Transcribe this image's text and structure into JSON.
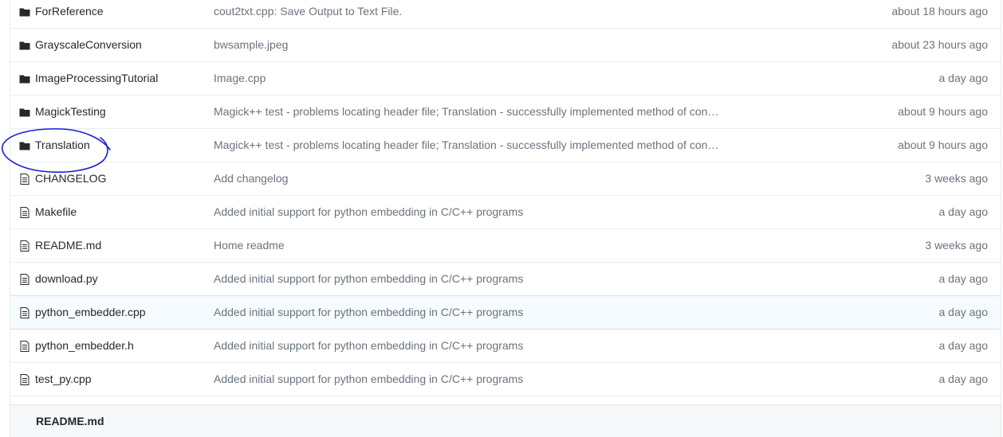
{
  "files": [
    {
      "type": "folder",
      "icon": "folder-icon",
      "name": "ForReference",
      "message": "cout2txt.cpp: Save Output to Text File.",
      "age": "about 18 hours ago"
    },
    {
      "type": "folder",
      "icon": "folder-icon",
      "name": "GrayscaleConversion",
      "message": "bwsample.jpeg",
      "age": "about 23 hours ago"
    },
    {
      "type": "folder",
      "icon": "folder-icon",
      "name": "ImageProcessingTutorial",
      "message": "Image.cpp",
      "age": "a day ago"
    },
    {
      "type": "folder",
      "icon": "folder-icon",
      "name": "MagickTesting",
      "message": "Magick++ test - problems locating header file; Translation - successfully implemented method of conv…",
      "age": "about 9 hours ago"
    },
    {
      "type": "folder",
      "icon": "folder-icon",
      "name": "Translation",
      "message": "Magick++ test - problems locating header file; Translation - successfully implemented method of conv…",
      "age": "about 9 hours ago"
    },
    {
      "type": "file",
      "icon": "file-icon",
      "name": "CHANGELOG",
      "message": "Add changelog",
      "age": "3 weeks ago"
    },
    {
      "type": "file",
      "icon": "file-icon",
      "name": "Makefile",
      "message": "Added initial support for python embedding in C/C++ programs",
      "age": "a day ago"
    },
    {
      "type": "file",
      "icon": "file-icon",
      "name": "README.md",
      "message": "Home readme",
      "age": "3 weeks ago"
    },
    {
      "type": "file",
      "icon": "file-icon",
      "name": "download.py",
      "message": "Added initial support for python embedding in C/C++ programs",
      "age": "a day ago"
    },
    {
      "type": "file",
      "icon": "file-icon",
      "name": "python_embedder.cpp",
      "message": "Added initial support for python embedding in C/C++ programs",
      "age": "a day ago"
    },
    {
      "type": "file",
      "icon": "file-icon",
      "name": "python_embedder.h",
      "message": "Added initial support for python embedding in C/C++ programs",
      "age": "a day ago"
    },
    {
      "type": "file",
      "icon": "file-icon",
      "name": "test_py.cpp",
      "message": "Added initial support for python embedding in C/C++ programs",
      "age": "a day ago"
    }
  ],
  "hovered_row": 9,
  "annotation": {
    "shape": "hand-drawn-circle",
    "color": "#1a1ad8",
    "target_row": 4
  },
  "readme": {
    "title": "README.md"
  },
  "colors": {
    "text": "#24292e",
    "muted": "#6a737d",
    "border": "#eaecef",
    "hover_bg": "#f6fbff",
    "hover_border": "#c8e1ff"
  }
}
